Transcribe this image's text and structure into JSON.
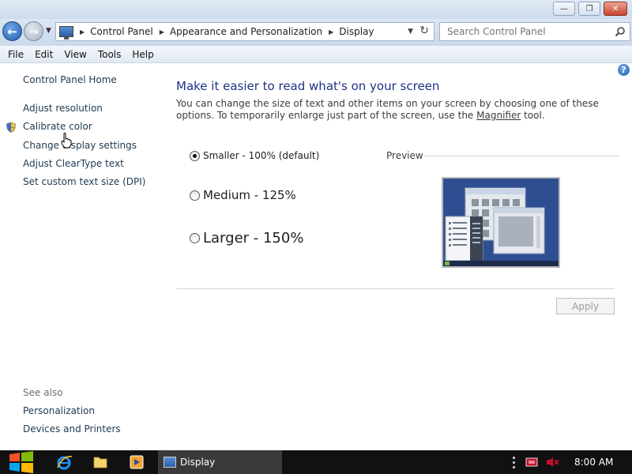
{
  "window": {
    "minimize_glyph": "—",
    "maximize_glyph": "❐",
    "close_glyph": "✕"
  },
  "nav": {
    "back_glyph": "←",
    "forward_glyph": "→",
    "breadcrumbs": [
      "Control Panel",
      "Appearance and Personalization",
      "Display"
    ],
    "search_placeholder": "Search Control Panel"
  },
  "menu": [
    "File",
    "Edit",
    "View",
    "Tools",
    "Help"
  ],
  "sidebar": {
    "home": "Control Panel Home",
    "links": [
      "Adjust resolution",
      "Calibrate color",
      "Change display settings",
      "Adjust ClearType text",
      "Set custom text size (DPI)"
    ],
    "see_also_title": "See also",
    "see_also": [
      "Personalization",
      "Devices and Printers"
    ]
  },
  "main": {
    "title": "Make it easier to read what's on your screen",
    "desc_part1": "You can change the size of text and other items on your screen by choosing one of these options. To temporarily enlarge just part of the screen, use the ",
    "magnifier_link": "Magnifier",
    "desc_part2": " tool.",
    "options": [
      {
        "label": "Smaller - 100% (default)",
        "selected": true
      },
      {
        "label": "Medium - 125%",
        "selected": false
      },
      {
        "label": "Larger - 150%",
        "selected": false
      }
    ],
    "preview_label": "Preview",
    "apply_label": "Apply"
  },
  "taskbar": {
    "active_app": "Display",
    "clock": "8:00 AM"
  },
  "colors": {
    "title_blue": "#1e3287",
    "link": "#1e3950",
    "taskbar": "#111111"
  },
  "icons": [
    "search-icon",
    "help-icon",
    "shield-icon",
    "hand-cursor-icon",
    "windows-logo-icon",
    "internet-explorer-icon",
    "folder-icon",
    "media-player-icon",
    "action-center-icon",
    "speaker-muted-icon"
  ]
}
